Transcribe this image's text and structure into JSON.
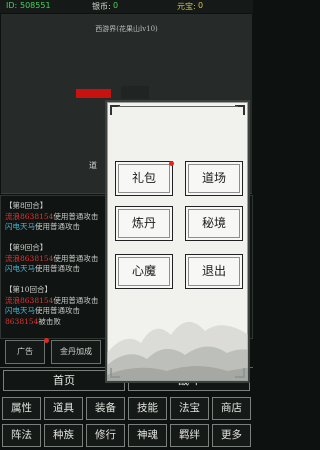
{
  "topbar": {
    "id_label": "ID:",
    "id_value": "508551",
    "silver_label": "银币:",
    "silver_value": "0",
    "yuanbao_label": "元宝:",
    "yuanbao_value": "0"
  },
  "battle": {
    "title": "西游界(花果山lv10)",
    "dao_label": "道"
  },
  "log": [
    {
      "parts": [
        {
          "t": "【第8回合】",
          "c": "c-round"
        }
      ]
    },
    {
      "parts": [
        {
          "t": "流浪8638154",
          "c": "c-red"
        },
        {
          "t": "使用普通攻击",
          "c": "c-grey"
        }
      ]
    },
    {
      "parts": [
        {
          "t": "闪电天马",
          "c": "c-cyan"
        },
        {
          "t": "使用普通攻击",
          "c": "c-grey"
        }
      ]
    },
    {
      "parts": [
        {
          "t": "",
          "c": "c-grey"
        }
      ]
    },
    {
      "parts": [
        {
          "t": "【第9回合】",
          "c": "c-round"
        }
      ]
    },
    {
      "parts": [
        {
          "t": "流浪8638154",
          "c": "c-red"
        },
        {
          "t": "使用普通攻击",
          "c": "c-grey"
        }
      ]
    },
    {
      "parts": [
        {
          "t": "闪电天马",
          "c": "c-cyan"
        },
        {
          "t": "使用普通攻击",
          "c": "c-grey"
        }
      ]
    },
    {
      "parts": [
        {
          "t": "",
          "c": "c-grey"
        }
      ]
    },
    {
      "parts": [
        {
          "t": "【第10回合】",
          "c": "c-round"
        }
      ]
    },
    {
      "parts": [
        {
          "t": "流浪8638154",
          "c": "c-red"
        },
        {
          "t": "使用普通攻击",
          "c": "c-grey"
        }
      ]
    },
    {
      "parts": [
        {
          "t": "闪电天马",
          "c": "c-cyan"
        },
        {
          "t": "使用普通攻击",
          "c": "c-grey"
        }
      ]
    },
    {
      "parts": [
        {
          "t": "8638154",
          "c": "c-red"
        },
        {
          "t": "被击败",
          "c": "c-grey"
        }
      ]
    }
  ],
  "buttons": {
    "ad": "广告",
    "jindan": "金丹加成"
  },
  "tabs": {
    "home": "首页",
    "battle": "战斗"
  },
  "grid": [
    "属性",
    "道具",
    "装备",
    "技能",
    "法宝",
    "商店",
    "阵法",
    "种族",
    "修行",
    "神魂",
    "羁绊",
    "更多"
  ],
  "menu": {
    "items": [
      "礼包",
      "道场",
      "炼丹",
      "秘境",
      "心魔",
      "退出"
    ]
  },
  "colors": {
    "accent_green": "#46d35a",
    "alert_red": "#e12820",
    "player_red": "#e2342f",
    "enemy_cyan": "#47b7d8"
  }
}
